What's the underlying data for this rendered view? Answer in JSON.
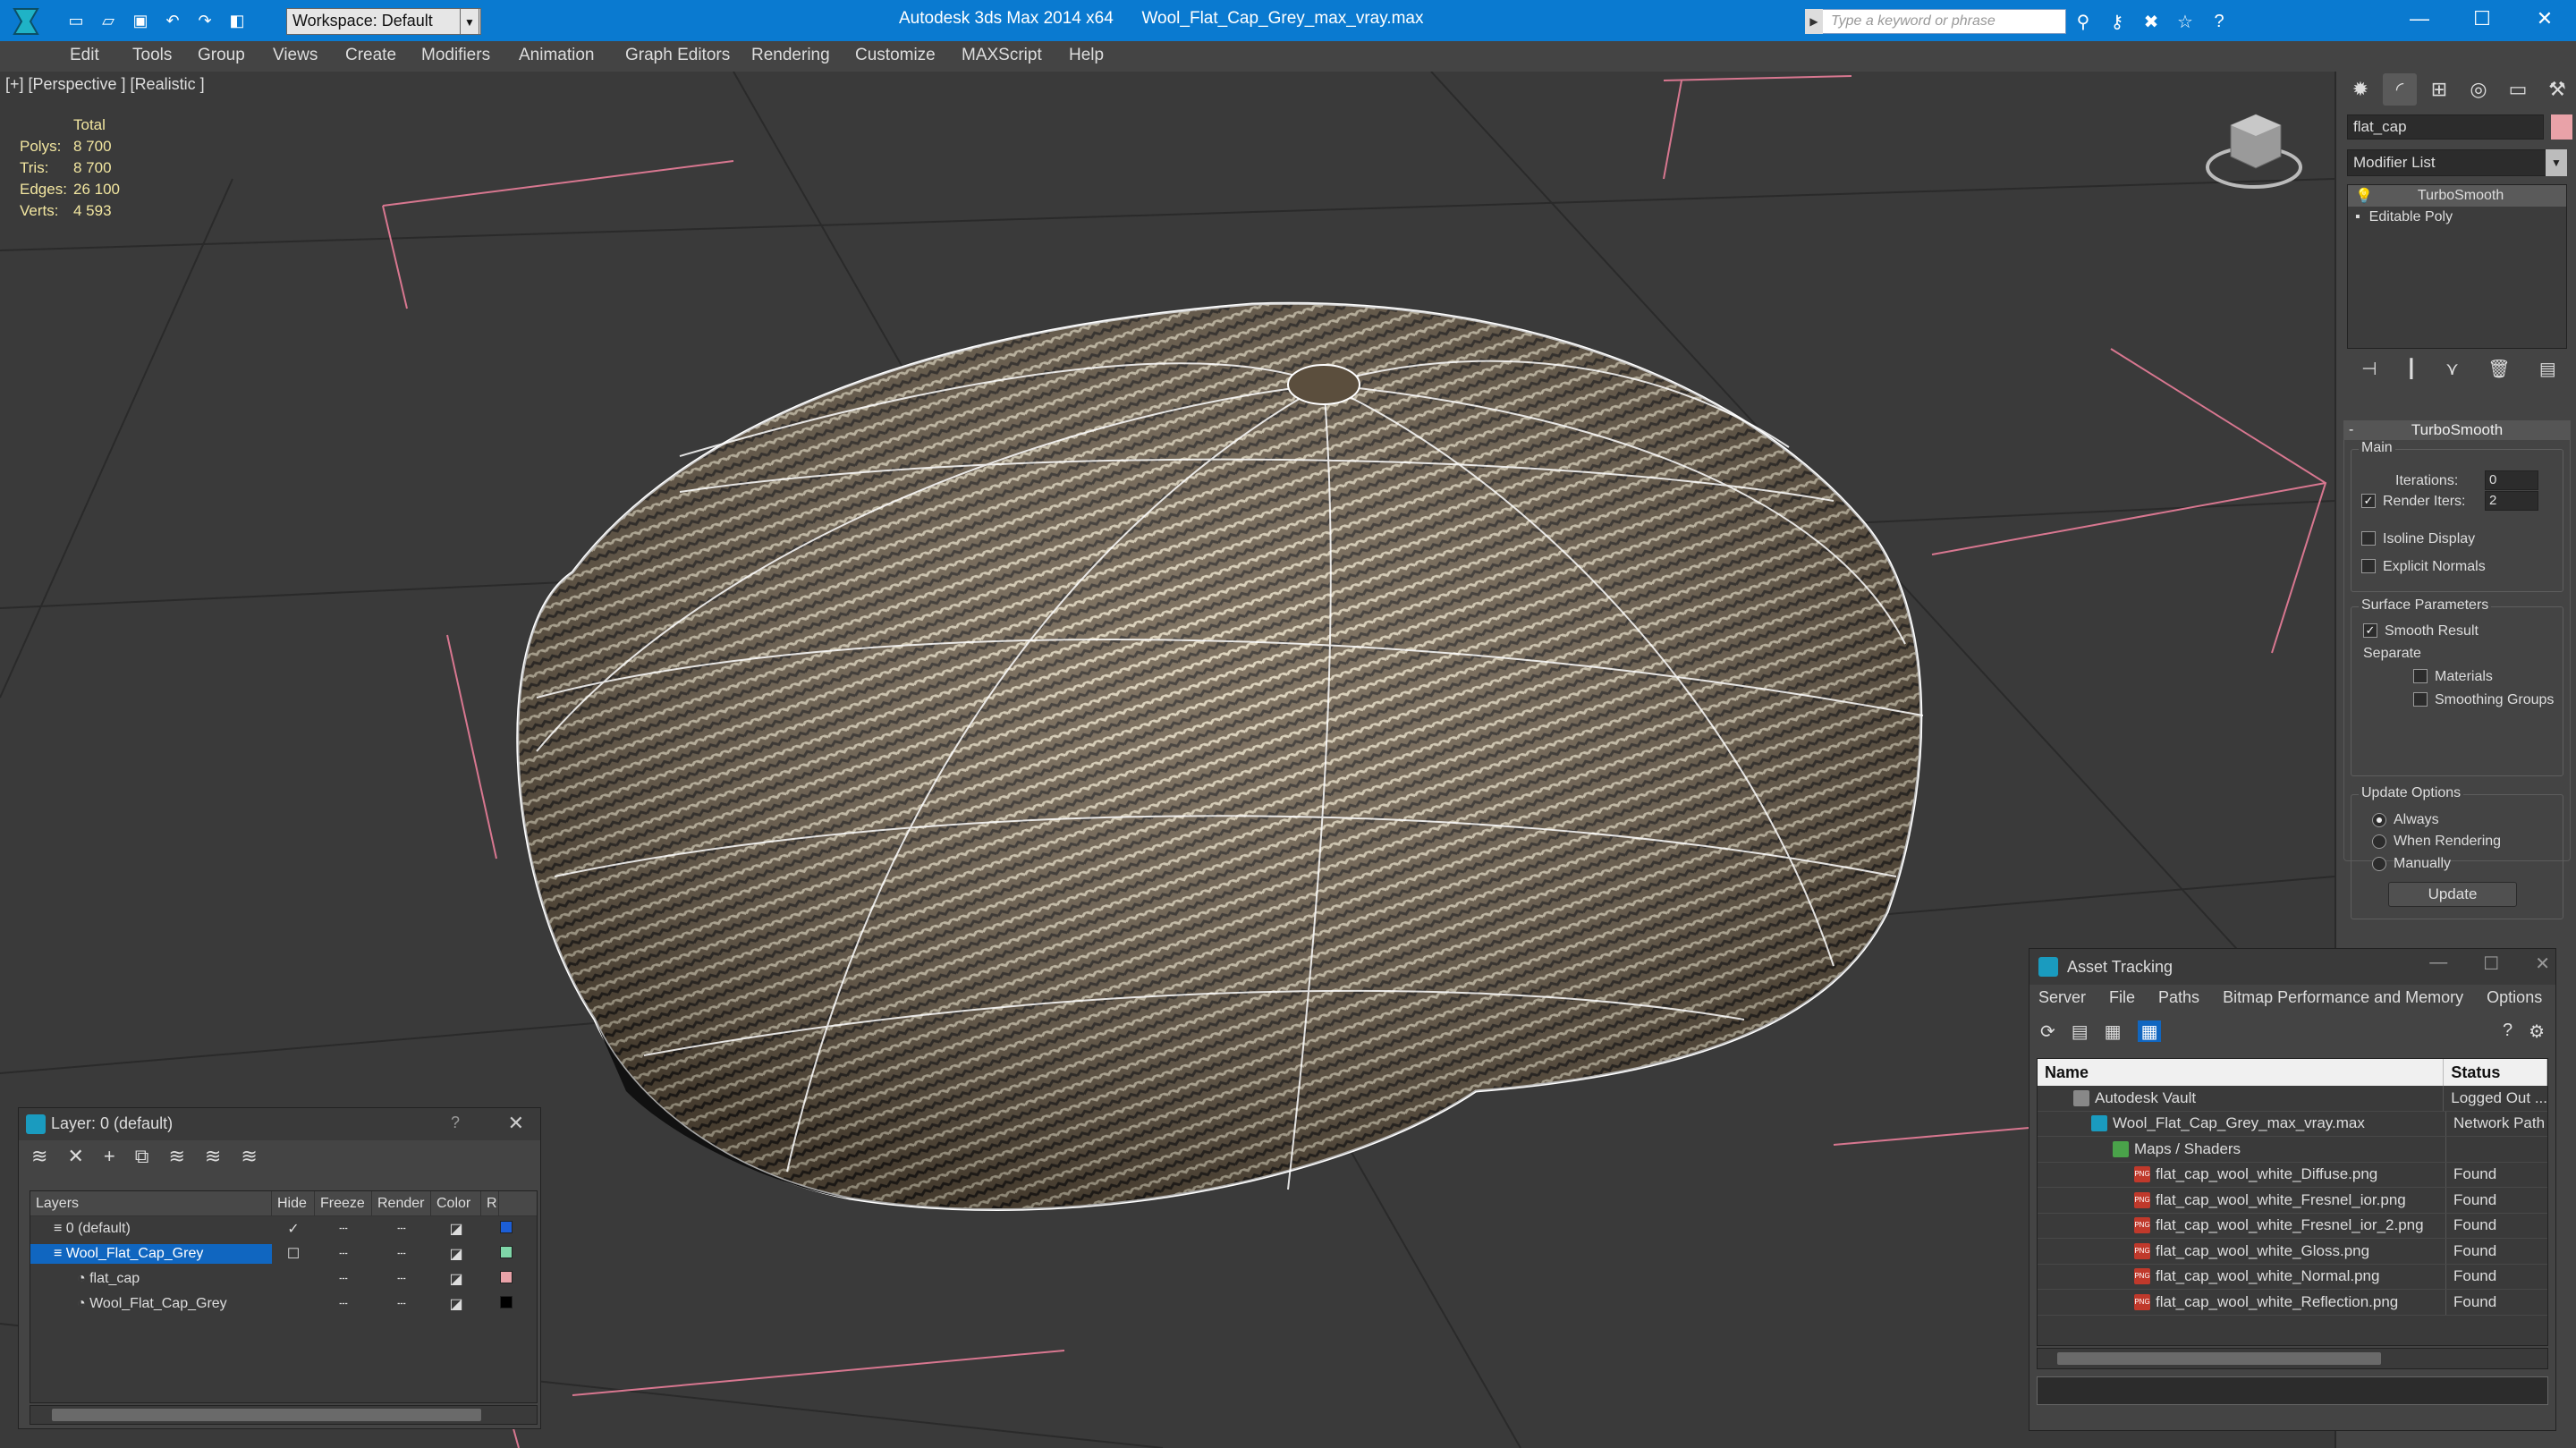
{
  "titlebar": {
    "workspace": "Workspace: Default",
    "app_title": "Autodesk 3ds Max  2014 x64",
    "file_title": "Wool_Flat_Cap_Grey_max_vray.max",
    "search_placeholder": "Type a keyword or phrase"
  },
  "menu": [
    "Edit",
    "Tools",
    "Group",
    "Views",
    "Create",
    "Modifiers",
    "Animation",
    "Graph Editors",
    "Rendering",
    "Customize",
    "MAXScript",
    "Help"
  ],
  "viewport": {
    "label": "[+] [Perspective ] [Realistic ]",
    "stats": {
      "header": "Total",
      "rows": [
        {
          "k": "Polys:",
          "v": "8 700"
        },
        {
          "k": "Tris:",
          "v": "8 700"
        },
        {
          "k": "Edges:",
          "v": "26 100"
        },
        {
          "k": "Verts:",
          "v": "4 593"
        }
      ]
    }
  },
  "command_panel": {
    "object_name": "flat_cap",
    "object_color": "#e9a2a8",
    "modifier_list": "Modifier List",
    "stack": [
      "TurboSmooth",
      "Editable Poly"
    ],
    "rollout_title": "TurboSmooth",
    "main_group": "Main",
    "iterations_label": "Iterations:",
    "iterations_value": "0",
    "render_iters_label": "Render Iters:",
    "render_iters_value": "2",
    "render_iters_checked": true,
    "isoline_label": "Isoline Display",
    "explicit_normals_label": "Explicit Normals",
    "surface_group": "Surface Parameters",
    "smooth_result_label": "Smooth Result",
    "separate_label": "Separate",
    "materials_label": "Materials",
    "smoothing_groups_label": "Smoothing Groups",
    "update_group": "Update Options",
    "always_label": "Always",
    "when_rendering_label": "When Rendering",
    "manually_label": "Manually",
    "update_button": "Update"
  },
  "layer_window": {
    "title": "Layer: 0 (default)",
    "help": "?",
    "columns": [
      "Layers",
      "Hide",
      "Freeze",
      "Render",
      "Color",
      "R"
    ],
    "rows": [
      {
        "name": "0 (default)",
        "color": "#1c5ed6",
        "indent": 1
      },
      {
        "name": "Wool_Flat_Cap_Grey",
        "color": "#7fd6a8",
        "indent": 1
      },
      {
        "name": "flat_cap",
        "color": "#e9a2a8",
        "indent": 2
      },
      {
        "name": "Wool_Flat_Cap_Grey",
        "color": "#000000",
        "indent": 2
      }
    ]
  },
  "asset_window": {
    "title": "Asset Tracking",
    "menu": [
      "Server",
      "File",
      "Paths",
      "Bitmap Performance and Memory",
      "Options"
    ],
    "columns": [
      "Name",
      "Status"
    ],
    "rows": [
      {
        "name": "Autodesk Vault",
        "status": "Logged Out ...",
        "indent": 1
      },
      {
        "name": "Wool_Flat_Cap_Grey_max_vray.max",
        "status": "Network Path",
        "indent": 2
      },
      {
        "name": "Maps / Shaders",
        "status": "",
        "indent": 3
      },
      {
        "name": "flat_cap_wool_white_Diffuse.png",
        "status": "Found",
        "indent": 4
      },
      {
        "name": "flat_cap_wool_white_Fresnel_ior.png",
        "status": "Found",
        "indent": 4
      },
      {
        "name": "flat_cap_wool_white_Fresnel_ior_2.png",
        "status": "Found",
        "indent": 4
      },
      {
        "name": "flat_cap_wool_white_Gloss.png",
        "status": "Found",
        "indent": 4
      },
      {
        "name": "flat_cap_wool_white_Normal.png",
        "status": "Found",
        "indent": 4
      },
      {
        "name": "flat_cap_wool_white_Reflection.png",
        "status": "Found",
        "indent": 4
      }
    ]
  }
}
